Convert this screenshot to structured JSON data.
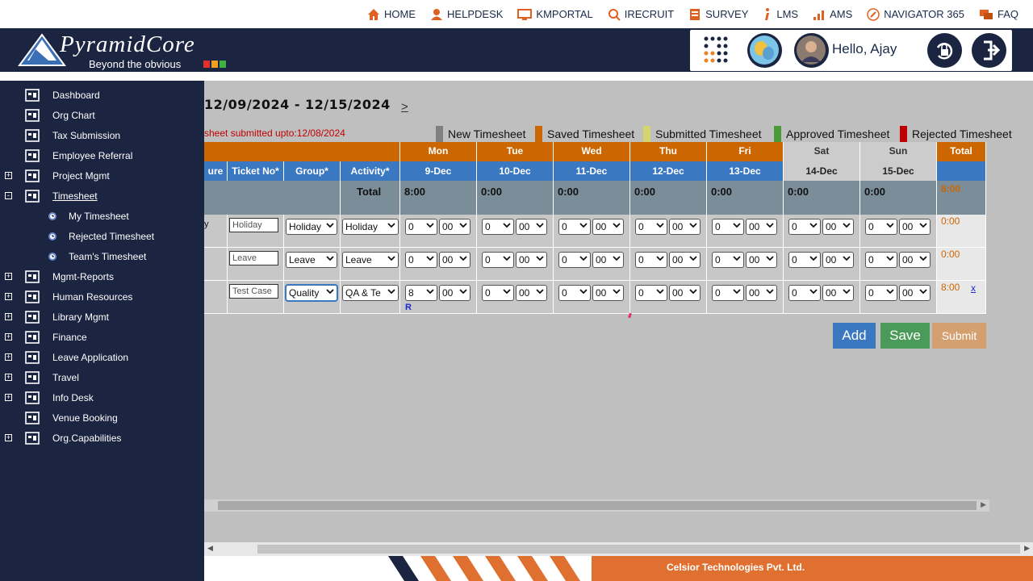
{
  "topnav": [
    "HOME",
    "HELPDESK",
    "KMPORTAL",
    "IRECRUIT",
    "SURVEY",
    "LMS",
    "AMS",
    "NAVIGATOR 365",
    "FAQ"
  ],
  "brand": {
    "name": "PyramidCore",
    "tagline": "Beyond the obvious"
  },
  "user": {
    "greeting": "Hello, Ajay"
  },
  "sidebar": {
    "items": [
      {
        "label": "Dashboard"
      },
      {
        "label": "Org Chart"
      },
      {
        "label": "Tax Submission"
      },
      {
        "label": "Employee Referral"
      },
      {
        "label": "Project Mgmt",
        "expand": "+"
      },
      {
        "label": "Timesheet",
        "expand": "-"
      },
      {
        "label": "My Timesheet"
      },
      {
        "label": "Rejected Timesheet"
      },
      {
        "label": "Team's Timesheet"
      },
      {
        "label": "Mgmt-Reports",
        "expand": "+"
      },
      {
        "label": "Human Resources",
        "expand": "+"
      },
      {
        "label": "Library Mgmt",
        "expand": "+"
      },
      {
        "label": "Finance",
        "expand": "+"
      },
      {
        "label": "Leave Application",
        "expand": "+"
      },
      {
        "label": "Travel",
        "expand": "+"
      },
      {
        "label": "Info Desk",
        "expand": "+"
      },
      {
        "label": "Venue Booking"
      },
      {
        "label": "Org.Capabilities",
        "expand": "+"
      }
    ]
  },
  "timesheet": {
    "week": "12/09/2024 - 12/15/2024",
    "next": ">",
    "submitted_note": "sheet submitted upto:12/08/2024",
    "legend": [
      {
        "label": "New Timesheet",
        "color": "#808080"
      },
      {
        "label": "Saved Timesheet",
        "color": "#cc6600"
      },
      {
        "label": "Submitted Timesheet",
        "color": "#d4d470"
      },
      {
        "label": "Approved Timesheet",
        "color": "#4a9a3a"
      },
      {
        "label": "Rejected Timesheet",
        "color": "#c00000"
      }
    ],
    "columns": {
      "feature": "ure",
      "ticket": "Ticket No*",
      "group": "Group*",
      "activity": "Activity*",
      "total_label": "Total",
      "total_col": "Total"
    },
    "days": [
      {
        "day": "Mon",
        "date": "9-Dec",
        "total": "8:00"
      },
      {
        "day": "Tue",
        "date": "10-Dec",
        "total": "0:00"
      },
      {
        "day": "Wed",
        "date": "11-Dec",
        "total": "0:00"
      },
      {
        "day": "Thu",
        "date": "12-Dec",
        "total": "0:00"
      },
      {
        "day": "Fri",
        "date": "13-Dec",
        "total": "0:00"
      },
      {
        "day": "Sat",
        "date": "14-Dec",
        "total": "0:00"
      },
      {
        "day": "Sun",
        "date": "15-Dec",
        "total": "0:00"
      }
    ],
    "grand_total": "8:00",
    "rows": [
      {
        "prefix": "y",
        "ticket": "Holiday",
        "group": "Holiday",
        "activity": "Holiday",
        "hours": [
          "0",
          "0",
          "0",
          "0",
          "0",
          "0",
          "0"
        ],
        "mins": "00",
        "total": "0:00",
        "remove": ""
      },
      {
        "prefix": "",
        "ticket": "Leave",
        "group": "Leave",
        "activity": "Leave",
        "hours": [
          "0",
          "0",
          "0",
          "0",
          "0",
          "0",
          "0"
        ],
        "mins": "00",
        "total": "0:00",
        "remove": ""
      },
      {
        "prefix": "",
        "ticket": "Test Case",
        "group": "Quality",
        "activity": "QA & Te",
        "hours": [
          "8",
          "0",
          "0",
          "0",
          "0",
          "0",
          "0"
        ],
        "mins": "00",
        "total": "8:00",
        "remove": "x",
        "flag": "R"
      }
    ],
    "buttons": {
      "add": "Add",
      "save": "Save",
      "submit": "Submit"
    }
  },
  "footer": {
    "company": "Celsior Technologies Pvt. Ltd."
  },
  "colors": {
    "navy": "#1b2440",
    "orange": "#cc6600",
    "blue": "#3b78c2"
  }
}
